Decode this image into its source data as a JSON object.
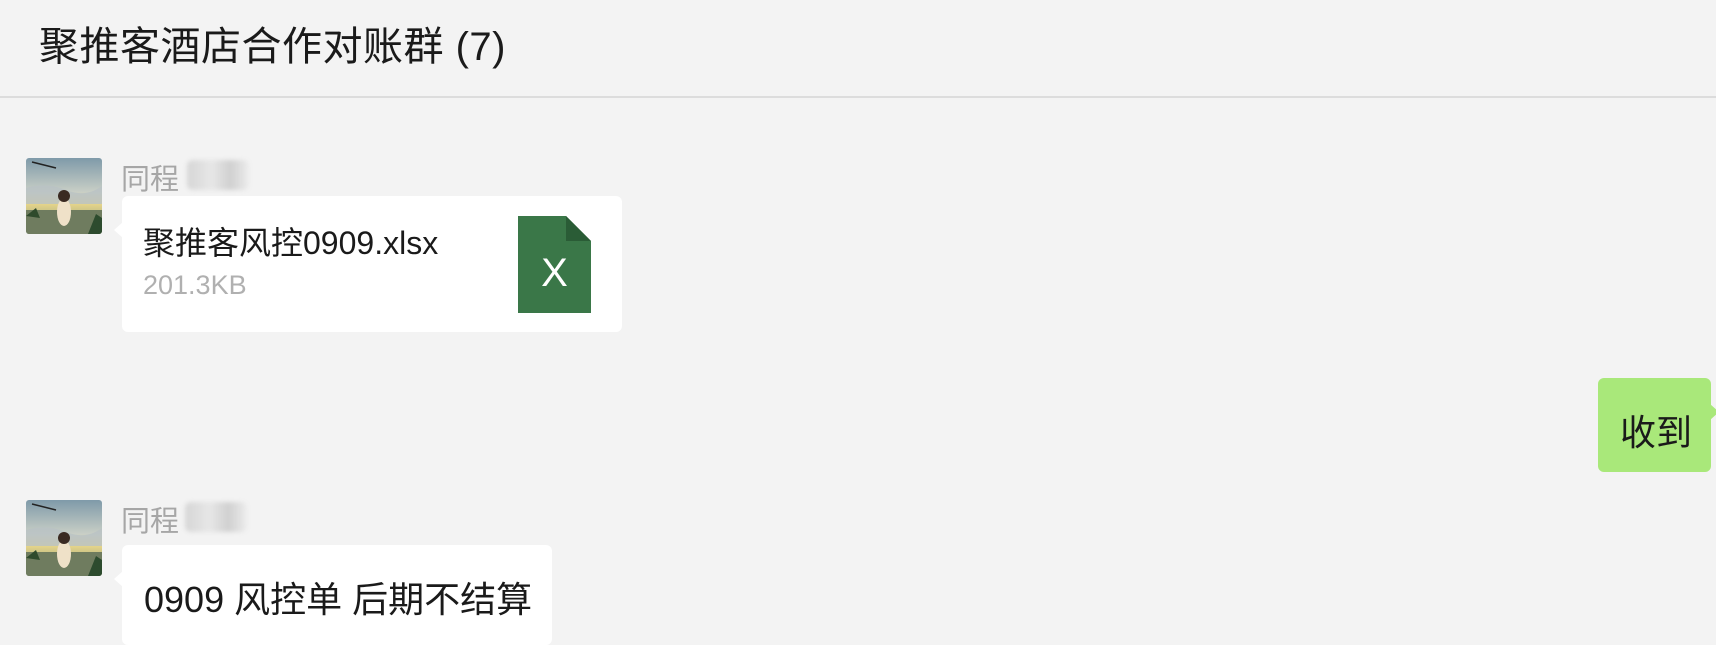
{
  "header": {
    "title": "聚推客酒店合作对账群 (7)"
  },
  "messages": [
    {
      "sender": "同程",
      "type": "file",
      "file": {
        "name": "聚推客风控0909.xlsx",
        "size": "201.3KB",
        "icon": "excel-file-icon",
        "icon_letter": "X",
        "icon_color": "#3a7748"
      }
    },
    {
      "sender": "self",
      "type": "text",
      "text": "收到",
      "bubble_color": "#a9e87a"
    },
    {
      "sender": "同程",
      "type": "text",
      "text": "0909 风控单  后期不结算"
    }
  ]
}
